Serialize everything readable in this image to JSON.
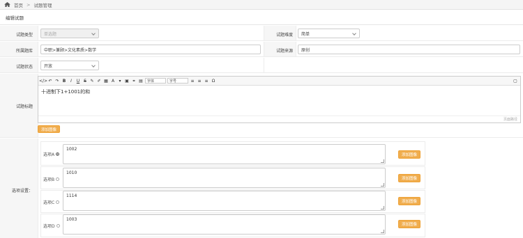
{
  "breadcrumb": {
    "home": "首页",
    "separator": ">",
    "current": "试题管理"
  },
  "panel": {
    "title": "编辑试题"
  },
  "form": {
    "question_type": {
      "label": "试题类型",
      "value": "单选题"
    },
    "difficulty": {
      "label": "试题难度",
      "value": "简单"
    },
    "bank": {
      "label": "所属题库",
      "value": "中职>兼顾>文化素质>数学"
    },
    "source": {
      "label": "试题来源",
      "value": "原创"
    },
    "status": {
      "label": "试题状态",
      "value": "开放"
    },
    "title": {
      "label": "试题标题",
      "content": "十进制下1+1001的和",
      "footer": "页面路径",
      "add_button": "添加图像"
    },
    "options": {
      "label": "选项设置：",
      "items": [
        {
          "label": "选项A",
          "value": "1002",
          "selected": true,
          "button": "添加图像"
        },
        {
          "label": "选项B",
          "value": "1010",
          "selected": false,
          "button": "添加图像"
        },
        {
          "label": "选项C",
          "value": "1114",
          "selected": false,
          "button": "添加图像"
        },
        {
          "label": "选项D",
          "value": "1003",
          "selected": false,
          "button": "添加图像"
        }
      ]
    }
  },
  "toolbar": {
    "font_family": "字体",
    "font_size": "字号"
  }
}
